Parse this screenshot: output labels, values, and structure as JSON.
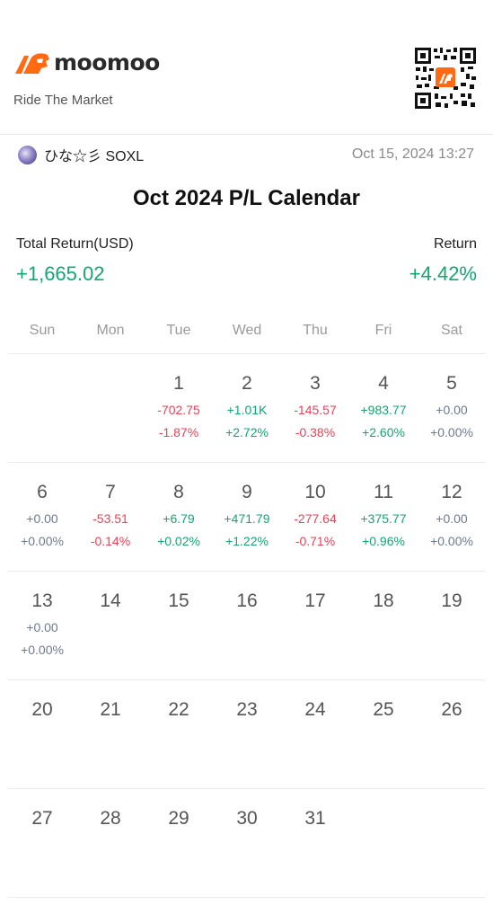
{
  "brand": {
    "name": "moomoo",
    "tagline": "Ride The Market",
    "accent_color": "#ff6a13"
  },
  "header": {
    "user_name": "ひな☆彡 SOXL",
    "timestamp": "Oct 15, 2024 13:27"
  },
  "title": "Oct 2024 P/L Calendar",
  "summary": {
    "total_return_label": "Total Return(USD)",
    "total_return_value": "+1,665.02",
    "return_label": "Return",
    "return_value": "+4.42%"
  },
  "colors": {
    "positive": "#10a870",
    "negative": "#ee3f55",
    "neutral": "#6e7a90"
  },
  "weekdays": [
    "Sun",
    "Mon",
    "Tue",
    "Wed",
    "Thu",
    "Fri",
    "Sat"
  ],
  "weeks": [
    [
      {
        "day": "",
        "amount": "",
        "percent": "",
        "tone": ""
      },
      {
        "day": "",
        "amount": "",
        "percent": "",
        "tone": ""
      },
      {
        "day": "1",
        "amount": "-702.75",
        "percent": "-1.87%",
        "tone": "neg"
      },
      {
        "day": "2",
        "amount": "+1.01K",
        "percent": "+2.72%",
        "tone": "pos"
      },
      {
        "day": "3",
        "amount": "-145.57",
        "percent": "-0.38%",
        "tone": "neg"
      },
      {
        "day": "4",
        "amount": "+983.77",
        "percent": "+2.60%",
        "tone": "pos"
      },
      {
        "day": "5",
        "amount": "+0.00",
        "percent": "+0.00%",
        "tone": "zero"
      }
    ],
    [
      {
        "day": "6",
        "amount": "+0.00",
        "percent": "+0.00%",
        "tone": "zero"
      },
      {
        "day": "7",
        "amount": "-53.51",
        "percent": "-0.14%",
        "tone": "neg"
      },
      {
        "day": "8",
        "amount": "+6.79",
        "percent": "+0.02%",
        "tone": "pos"
      },
      {
        "day": "9",
        "amount": "+471.79",
        "percent": "+1.22%",
        "tone": "pos"
      },
      {
        "day": "10",
        "amount": "-277.64",
        "percent": "-0.71%",
        "tone": "neg"
      },
      {
        "day": "11",
        "amount": "+375.77",
        "percent": "+0.96%",
        "tone": "pos"
      },
      {
        "day": "12",
        "amount": "+0.00",
        "percent": "+0.00%",
        "tone": "zero"
      }
    ],
    [
      {
        "day": "13",
        "amount": "+0.00",
        "percent": "+0.00%",
        "tone": "zero"
      },
      {
        "day": "14",
        "amount": "",
        "percent": "",
        "tone": ""
      },
      {
        "day": "15",
        "amount": "",
        "percent": "",
        "tone": ""
      },
      {
        "day": "16",
        "amount": "",
        "percent": "",
        "tone": ""
      },
      {
        "day": "17",
        "amount": "",
        "percent": "",
        "tone": ""
      },
      {
        "day": "18",
        "amount": "",
        "percent": "",
        "tone": ""
      },
      {
        "day": "19",
        "amount": "",
        "percent": "",
        "tone": ""
      }
    ],
    [
      {
        "day": "20",
        "amount": "",
        "percent": "",
        "tone": ""
      },
      {
        "day": "21",
        "amount": "",
        "percent": "",
        "tone": ""
      },
      {
        "day": "22",
        "amount": "",
        "percent": "",
        "tone": ""
      },
      {
        "day": "23",
        "amount": "",
        "percent": "",
        "tone": ""
      },
      {
        "day": "24",
        "amount": "",
        "percent": "",
        "tone": ""
      },
      {
        "day": "25",
        "amount": "",
        "percent": "",
        "tone": ""
      },
      {
        "day": "26",
        "amount": "",
        "percent": "",
        "tone": ""
      }
    ],
    [
      {
        "day": "27",
        "amount": "",
        "percent": "",
        "tone": ""
      },
      {
        "day": "28",
        "amount": "",
        "percent": "",
        "tone": ""
      },
      {
        "day": "29",
        "amount": "",
        "percent": "",
        "tone": ""
      },
      {
        "day": "30",
        "amount": "",
        "percent": "",
        "tone": ""
      },
      {
        "day": "31",
        "amount": "",
        "percent": "",
        "tone": ""
      },
      {
        "day": "",
        "amount": "",
        "percent": "",
        "tone": ""
      },
      {
        "day": "",
        "amount": "",
        "percent": "",
        "tone": ""
      }
    ]
  ]
}
